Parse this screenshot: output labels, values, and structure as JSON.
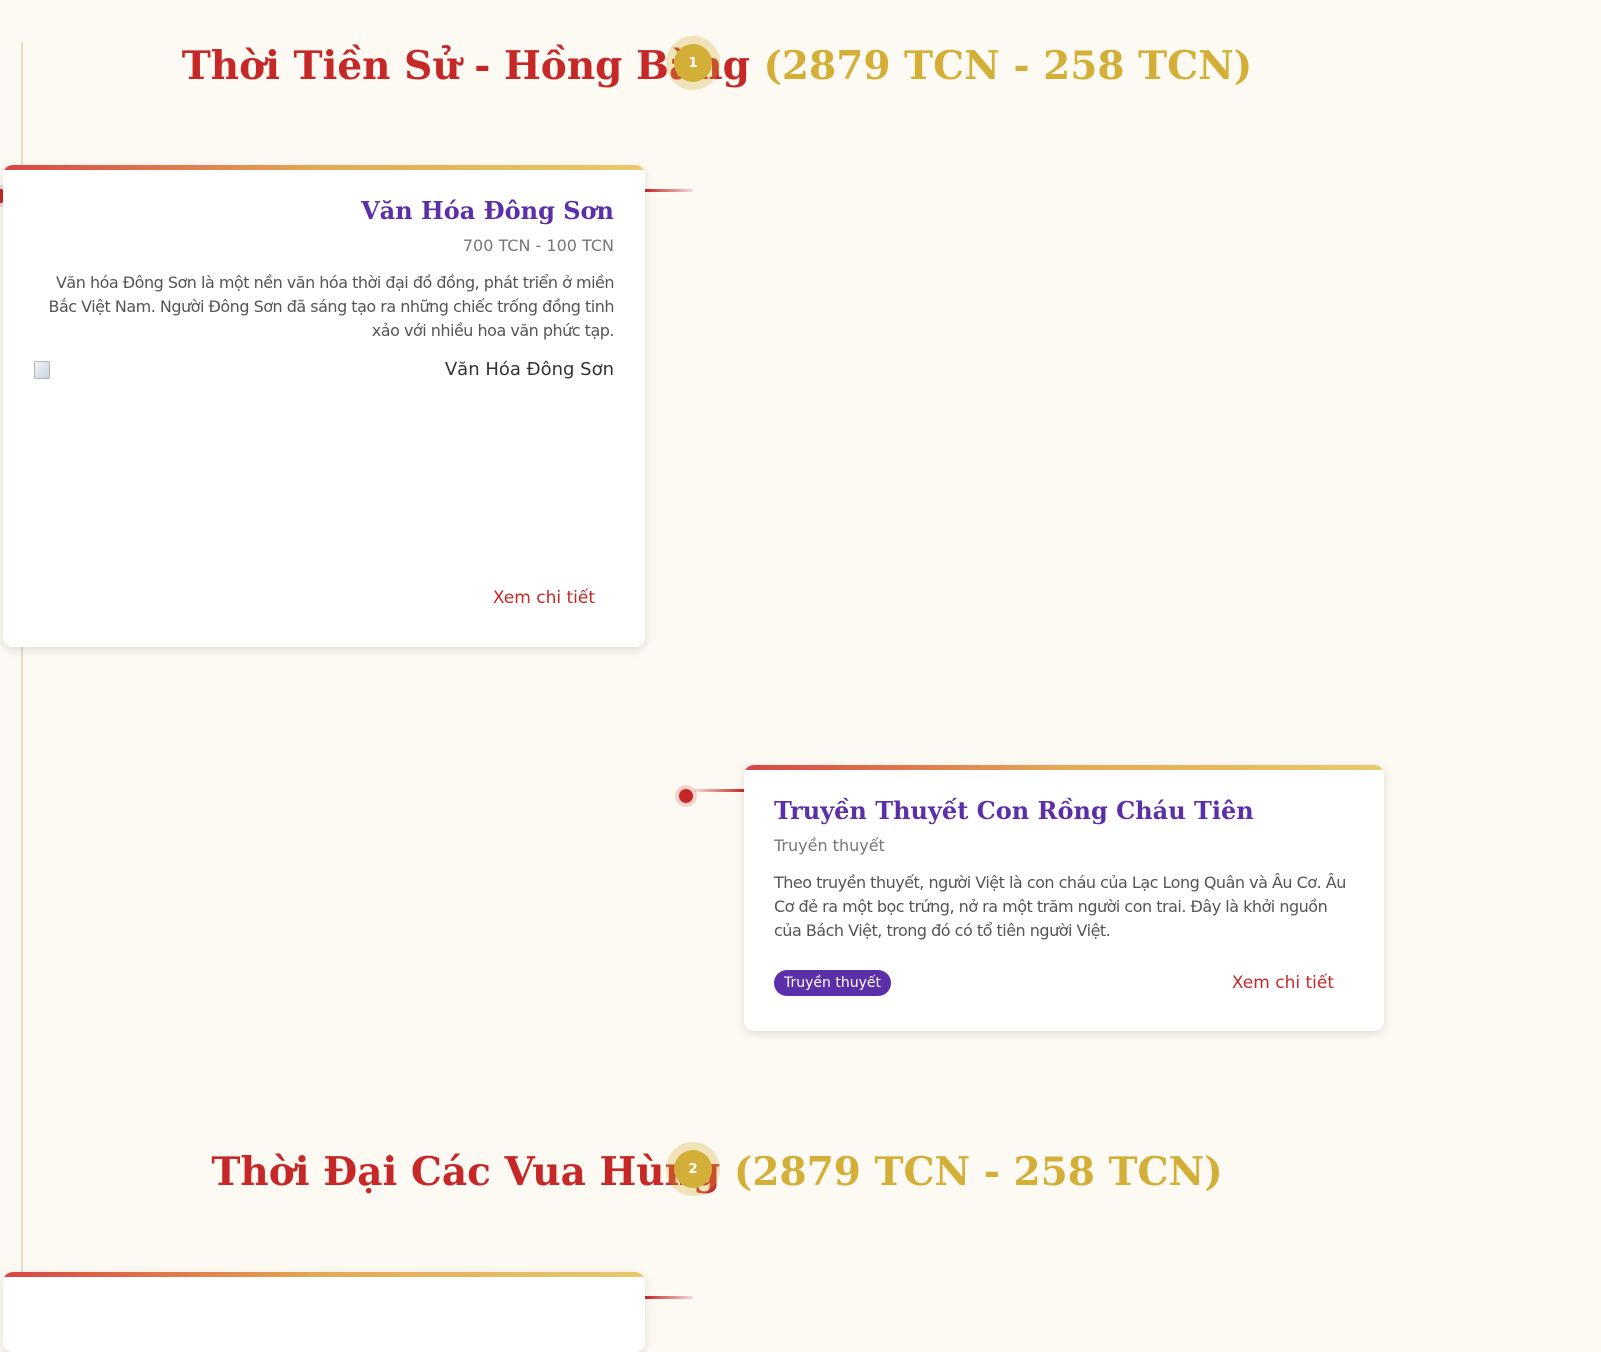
{
  "periods": [
    {
      "number": "1",
      "name": "Thời Tiền Sử - Hồng Bàng",
      "range": "(2879 TCN - 258 TCN)"
    },
    {
      "number": "2",
      "name": "Thời Đại Các Vua Hùng",
      "range": "(2879 TCN - 258 TCN)"
    }
  ],
  "events": [
    {
      "title": "Văn Hóa Đông Sơn",
      "date": "700 TCN - 100 TCN",
      "description": "Văn hóa Đông Sơn là một nền văn hóa thời đại đồ đồng, phát triển ở miền Bắc Việt Nam. Người Đông Sơn đã sáng tạo ra những chiếc trống đồng tinh xảo với nhiều hoa văn phức tạp.",
      "image_alt": "Văn Hóa Đông Sơn",
      "link_label": "Xem chi tiết"
    },
    {
      "title": "Truyền Thuyết Con Rồng Cháu Tiên",
      "date": "Truyền thuyết",
      "description": "Theo truyền thuyết, người Việt là con cháu của Lạc Long Quân và Âu Cơ. Âu Cơ đẻ ra một bọc trứng, nở ra một trăm người con trai. Đây là khởi nguồn của Bách Việt, trong đó có tổ tiên người Việt.",
      "tag": "Truyền thuyết",
      "link_label": "Xem chi tiết"
    }
  ],
  "colors": {
    "background": "#fdf9f3",
    "period_name": "#c62828",
    "period_range": "#d4af37",
    "card_title": "#5b2eaa",
    "tag_background": "#5b2eaa",
    "link": "#c62828",
    "timeline_dot": "#c62828",
    "period_marker": "#d4af37"
  }
}
